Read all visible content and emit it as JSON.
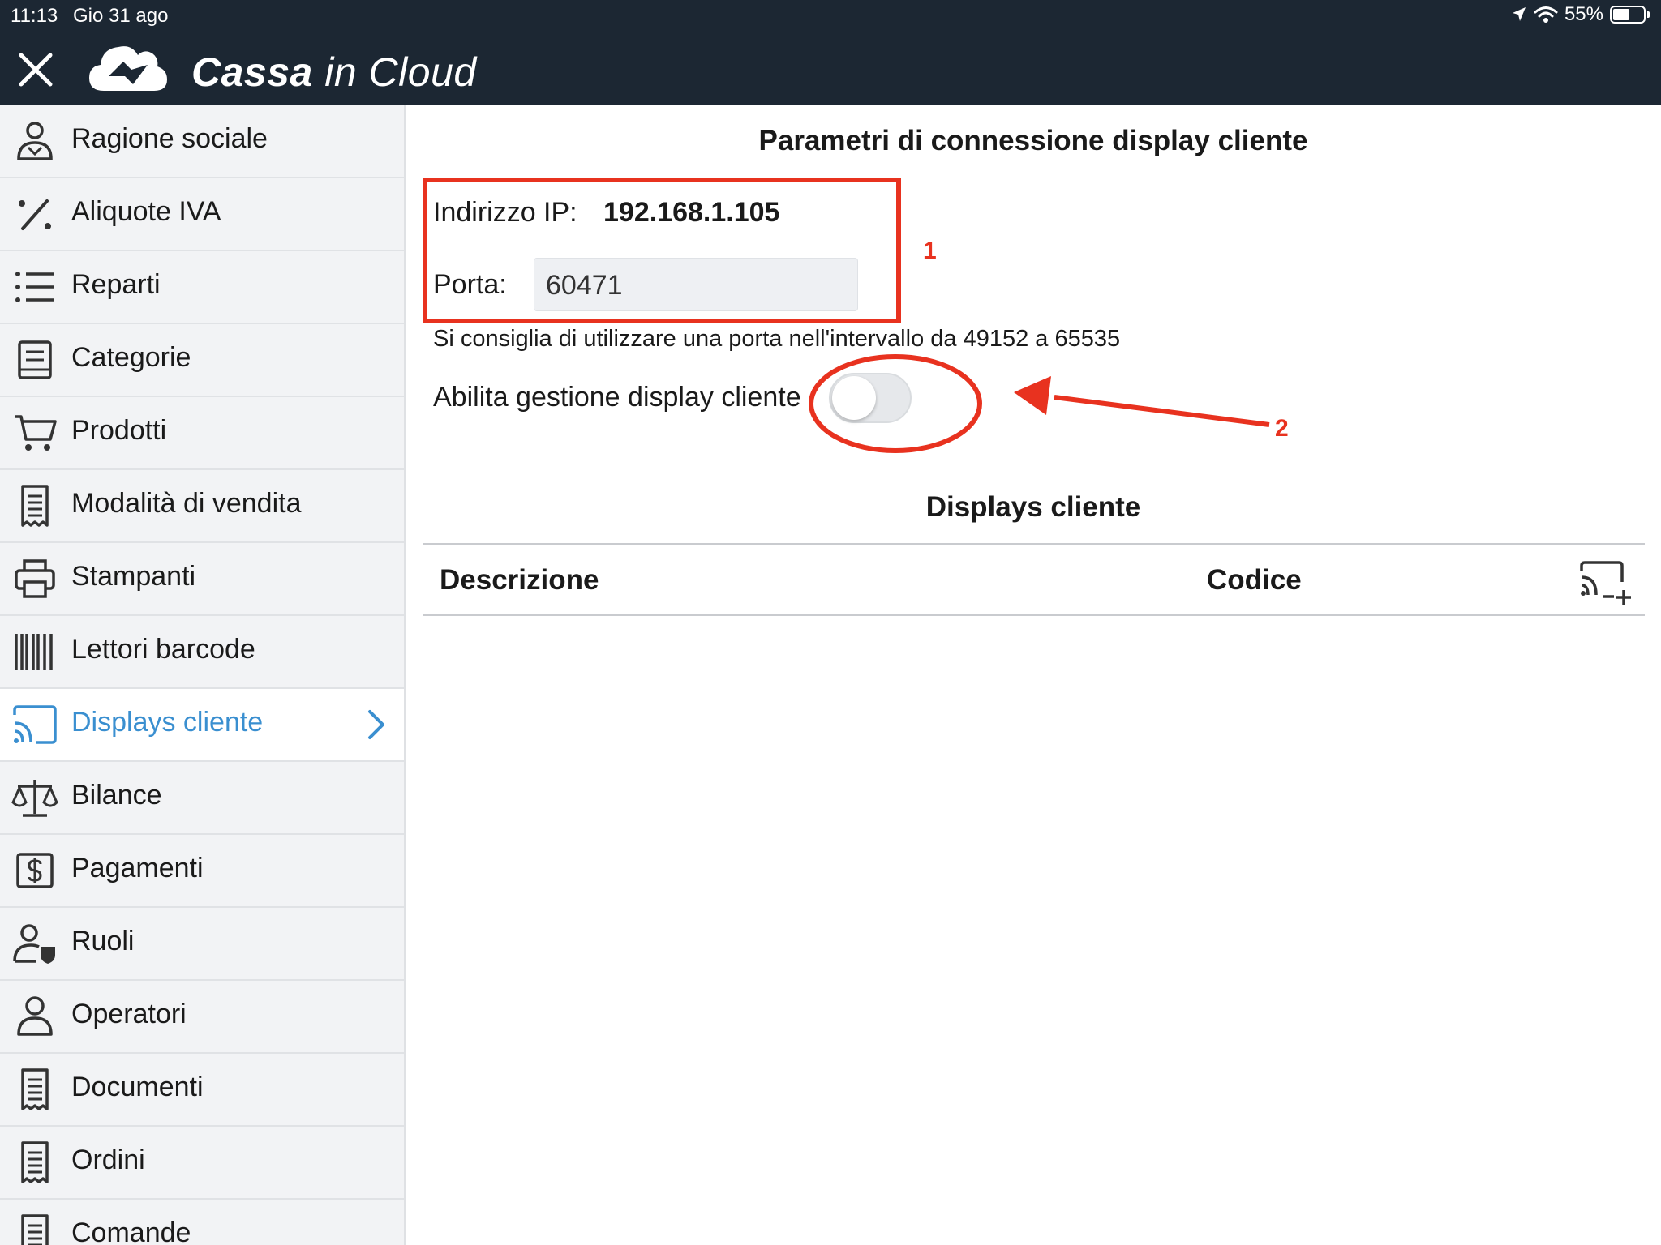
{
  "status_bar": {
    "time": "11:13",
    "date": "Gio 31 ago",
    "battery": "55%",
    "battery_level": 0.55
  },
  "header": {
    "title_bold": "Cassa",
    "title_light": "in Cloud",
    "close_icon": "close-icon",
    "logo_icon": "cloud-logo-icon"
  },
  "sidebar": {
    "items": [
      {
        "label": "Ragione sociale",
        "icon": "company-person-icon"
      },
      {
        "label": "Aliquote IVA",
        "icon": "percent-icon"
      },
      {
        "label": "Reparti",
        "icon": "list-icon"
      },
      {
        "label": "Categorie",
        "icon": "category-book-icon"
      },
      {
        "label": "Prodotti",
        "icon": "cart-icon"
      },
      {
        "label": "Modalità di vendita",
        "icon": "receipt-icon"
      },
      {
        "label": "Stampanti",
        "icon": "printer-icon"
      },
      {
        "label": "Lettori barcode",
        "icon": "barcode-icon"
      },
      {
        "label": "Displays cliente",
        "icon": "cast-icon",
        "active": true
      },
      {
        "label": "Bilance",
        "icon": "scale-icon"
      },
      {
        "label": "Pagamenti",
        "icon": "dollar-icon"
      },
      {
        "label": "Ruoli",
        "icon": "user-shield-icon"
      },
      {
        "label": "Operatori",
        "icon": "user-icon"
      },
      {
        "label": "Documenti",
        "icon": "document-receipt-icon"
      },
      {
        "label": "Ordini",
        "icon": "order-receipt-icon"
      },
      {
        "label": "Comande",
        "icon": "ticket-receipt-icon"
      }
    ]
  },
  "connection": {
    "title": "Parametri di connessione display cliente",
    "ip_label": "Indirizzo IP:",
    "ip_value": "192.168.1.105",
    "port_label": "Porta:",
    "port_value": "60471",
    "hint": "Si consiglia di utilizzare una porta nell'intervallo da 49152 a 65535",
    "toggle_label": "Abilita gestione display cliente",
    "toggle_on": false
  },
  "displays": {
    "title": "Displays cliente",
    "columns": [
      "Descrizione",
      "Codice"
    ],
    "add_icon": "add-cast-icon"
  },
  "annotations": {
    "label_1": "1",
    "label_2": "2",
    "color": "#e8321f"
  },
  "colors": {
    "header_bg": "#1c2733",
    "sidebar_bg": "#f2f3f5",
    "active_accent": "#3a8fd0"
  }
}
